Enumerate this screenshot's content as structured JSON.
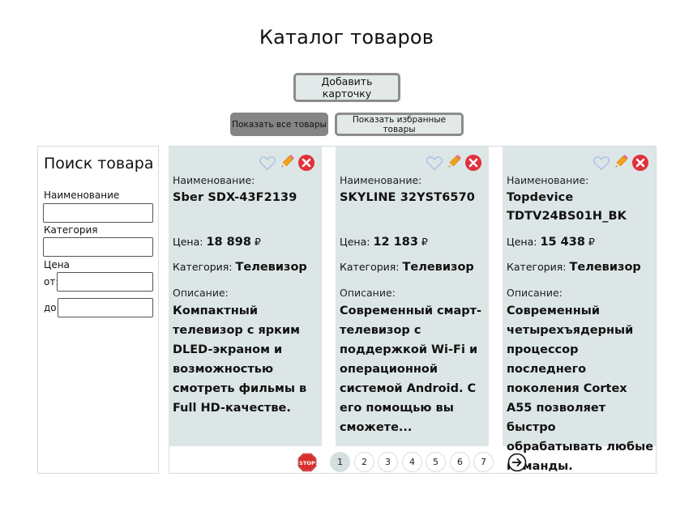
{
  "header": {
    "title": "Каталог товаров"
  },
  "actions": {
    "add_card": "Добавить карточку",
    "show_all": "Показать все товары",
    "show_favorites": "Показать избранные товары"
  },
  "search": {
    "title": "Поиск товара",
    "name_label": "Наименование",
    "name_value": "",
    "category_label": "Категория",
    "category_value": "",
    "price_label": "Цена",
    "from_label": "от:",
    "from_value": "",
    "to_label": "до:",
    "to_value": ""
  },
  "labels": {
    "name": "Наименование:",
    "price": "Цена:",
    "category": "Категория:",
    "description": "Описание:",
    "currency": "₽"
  },
  "cards": [
    {
      "name": "Sber SDX-43F2139",
      "price": "18 898",
      "category": "Телевизор",
      "description": "Компактный телевизор с ярким DLED-экраном и возможностью смотреть фильмы в Full HD-качестве."
    },
    {
      "name": "SKYLINE 32YST6570",
      "price": "12 183",
      "category": "Телевизор",
      "description": "Современный смарт-телевизор с поддержкой Wi-Fi и операционной системой Android. С его помощью вы сможете..."
    },
    {
      "name": "Topdevice TDTV24BS01H_BK",
      "price": "15 438",
      "category": "Телевизор",
      "description": "Современный четырехъядерный процессор последнего поколения Cortex A55 позволяет быстро обрабатывать любые команды."
    }
  ],
  "pagination": {
    "stop_label": "STOP",
    "pages": [
      "1",
      "2",
      "3",
      "4",
      "5",
      "6",
      "7"
    ],
    "current": "1"
  },
  "colors": {
    "card_bg": "#dde6e6",
    "delete_red": "#e0313c",
    "heart_outline": "#a9c2e8",
    "stop_red": "#d9302f"
  },
  "icons": {
    "favorite": "heart-outline-icon",
    "edit": "pencil-icon",
    "delete": "close-circle-icon",
    "first_page": "stop-sign-icon",
    "next_page": "arrow-right-circle-icon"
  }
}
